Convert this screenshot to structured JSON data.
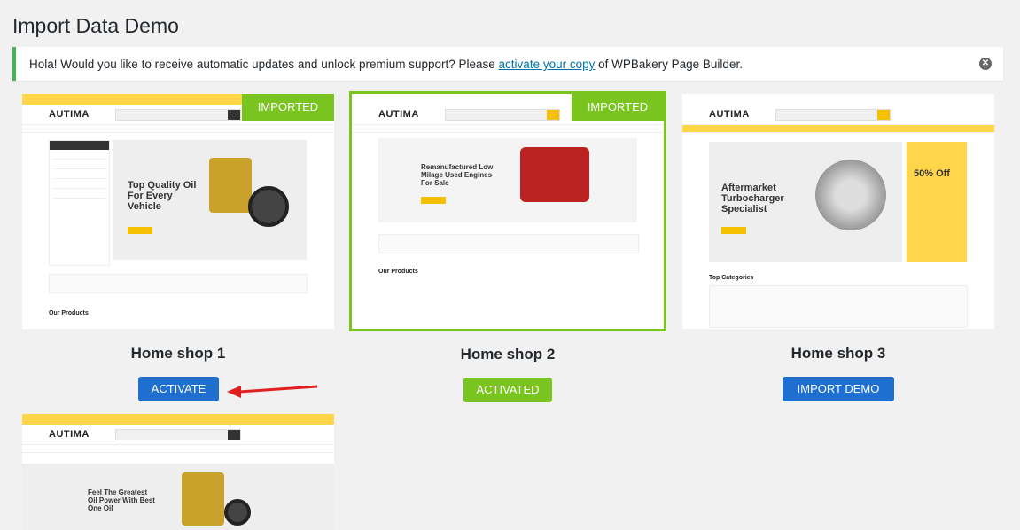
{
  "page_title": "Import Data Demo",
  "notice": {
    "before": "Hola! Would you like to receive automatic updates and unlock premium support? Please ",
    "link": "activate your copy",
    "after": " of WPBakery Page Builder."
  },
  "colors": {
    "accent_green": "#7ac41f",
    "accent_blue": "#1e6fd0",
    "site_yellow": "#ffd54a"
  },
  "demos": [
    {
      "title": "Home shop 1",
      "badge": "IMPORTED",
      "button": "ACTIVATE",
      "preview": {
        "logo": "AUTIMA",
        "headline": "Top Quality Oil For Every Vehicle"
      }
    },
    {
      "title": "Home shop 2",
      "badge": "IMPORTED",
      "button": "ACTIVATED",
      "preview": {
        "logo": "AUTIMA",
        "headline": "Remanufactured Low Milage Used Engines For Sale"
      }
    },
    {
      "title": "Home shop 3",
      "badge": "",
      "button": "IMPORT DEMO",
      "preview": {
        "logo": "AUTIMA",
        "headline": "Aftermarket Turbocharger Specialist",
        "side_promo": "50% Off"
      }
    },
    {
      "title": "",
      "badge": "",
      "button": "",
      "preview": {
        "logo": "AUTIMA",
        "headline": "Feel The Greatest Oil Power With Best One Oil"
      }
    }
  ]
}
